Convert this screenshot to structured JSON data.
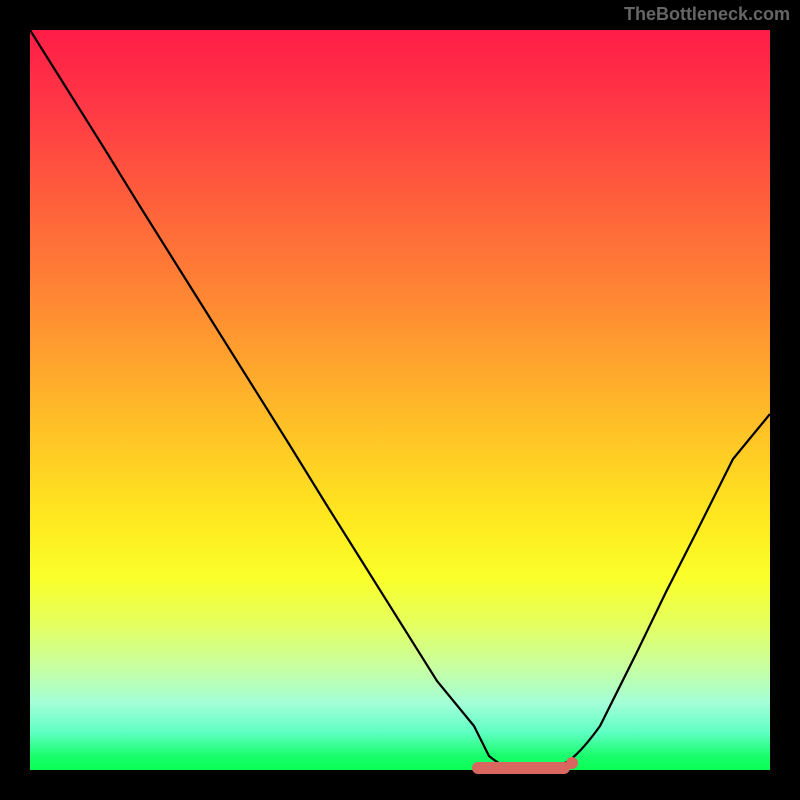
{
  "watermark": "TheBottleneck.com",
  "colors": {
    "background": "#000000",
    "curve": "#000000",
    "highlight": "#d9675f"
  },
  "chart_data": {
    "type": "line",
    "title": "",
    "xlabel": "",
    "ylabel": "",
    "xlim": [
      0,
      100
    ],
    "ylim": [
      0,
      100
    ],
    "series": [
      {
        "name": "bottleneck-curve",
        "x": [
          0,
          5,
          10,
          15,
          20,
          25,
          30,
          35,
          40,
          45,
          50,
          55,
          60,
          62,
          65,
          68,
          70,
          72,
          75,
          78,
          82,
          86,
          90,
          95,
          100
        ],
        "y": [
          100,
          92,
          84,
          76,
          68,
          60,
          52,
          44,
          36,
          28,
          20,
          12,
          6,
          3,
          1,
          0.3,
          0.2,
          0.3,
          1,
          3,
          8,
          16,
          25,
          36,
          48
        ]
      }
    ],
    "highlight_region": {
      "x_start": 60,
      "x_end": 73
    },
    "highlight_point": {
      "x": 73,
      "y": 1.5
    },
    "gradient_stops": [
      {
        "pos": 0,
        "color": "#ff1d47"
      },
      {
        "pos": 33,
        "color": "#ff7d36"
      },
      {
        "pos": 66,
        "color": "#ffe81f"
      },
      {
        "pos": 100,
        "color": "#0aff55"
      }
    ]
  }
}
